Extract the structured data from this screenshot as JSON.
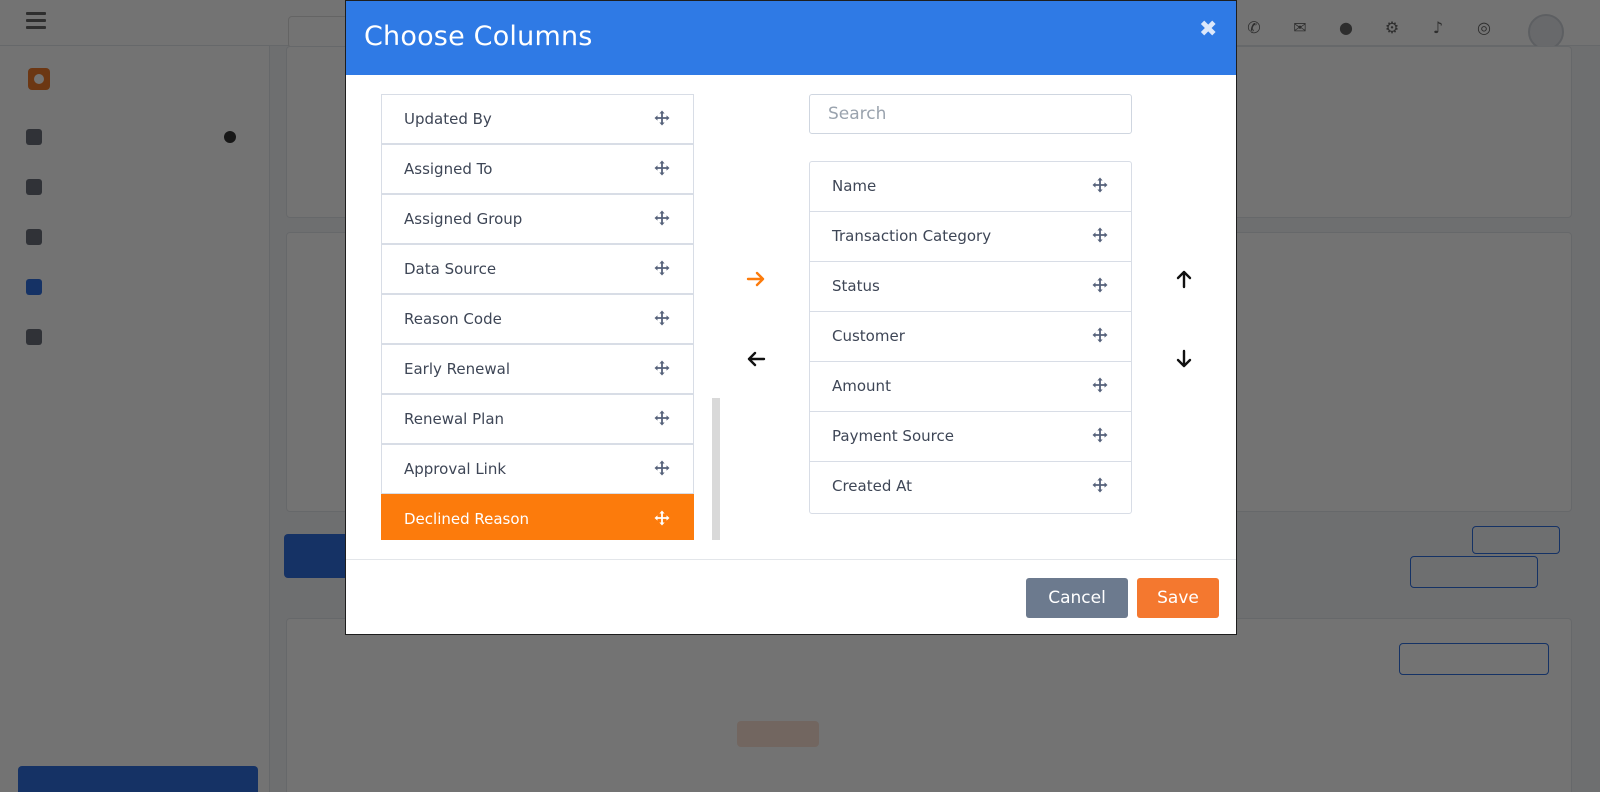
{
  "modal": {
    "title": "Choose Columns",
    "close_icon": "close-icon",
    "search_placeholder": "Search",
    "available_columns": [
      {
        "label": "Updated By"
      },
      {
        "label": "Assigned To"
      },
      {
        "label": "Assigned Group"
      },
      {
        "label": "Data Source"
      },
      {
        "label": "Reason Code"
      },
      {
        "label": "Early Renewal"
      },
      {
        "label": "Renewal Plan"
      },
      {
        "label": "Approval Link"
      },
      {
        "label": "Declined Reason",
        "selected": true
      }
    ],
    "selected_columns": [
      {
        "label": "Name"
      },
      {
        "label": "Transaction Category"
      },
      {
        "label": "Status"
      },
      {
        "label": "Customer"
      },
      {
        "label": "Amount"
      },
      {
        "label": "Payment Source"
      },
      {
        "label": "Created At"
      }
    ],
    "cancel_label": "Cancel",
    "save_label": "Save",
    "colors": {
      "header": "#2f7ae5",
      "selected_item": "#fc7b0c",
      "add_arrow": "#fc7b0c",
      "cancel": "#6c7a8e",
      "save": "#f4782f"
    }
  }
}
